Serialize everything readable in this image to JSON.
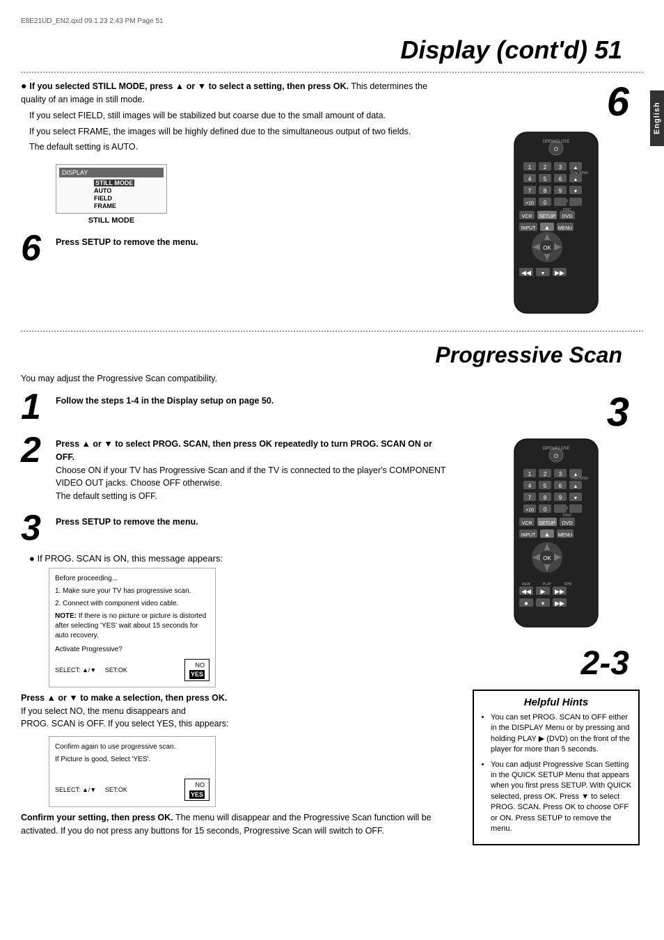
{
  "header": {
    "meta": "E8E21UD_EN2.qxd  09.1.23  2:43 PM  Page 51"
  },
  "english_tab": "English",
  "page_title": "Display (cont'd)  51",
  "section1": {
    "bullet1": {
      "bold_text": "If you selected STILL MODE, press ▲ or ▼ to select a setting, then press OK.",
      "rest": " This determines the quality of an image in still mode."
    },
    "field_text": "If you select FIELD, still images will be stabilized but coarse due to the small amount of data.",
    "frame_text": "If you select FRAME, the images will be highly defined due to the simultaneous output of two fields.",
    "default_text": "The default setting is AUTO.",
    "still_mode_caption": "STILL MODE"
  },
  "step6_display": {
    "num": "6",
    "text": "Press SETUP to remove the menu."
  },
  "section2_title": "Progressive Scan",
  "prog_intro": "You may adjust the Progressive Scan compatibility.",
  "step1": {
    "num": "1",
    "text": "Follow the steps 1-4 in the Display setup on page 50."
  },
  "step2": {
    "num": "2",
    "bold_text": "Press ▲ or ▼ to select PROG. SCAN, then press OK repeatedly to turn PROG. SCAN ON or OFF.",
    "rest": "Choose ON if your TV has Progressive Scan and if the TV is connected to the player's COMPONENT VIDEO OUT jacks. Choose OFF otherwise.",
    "default_text": "The default setting is OFF."
  },
  "step3": {
    "num": "3",
    "text": "Press SETUP to remove the menu."
  },
  "prog_scan_bullet": "If PROG. SCAN is ON, this message appears:",
  "dialog1": {
    "line1": "Before proceeding...",
    "line2": "1. Make sure your TV has progressive scan.",
    "line3": "2. Connect with component video cable.",
    "note": "NOTE: If there is no picture or picture is distorted after selecting 'YES' wait about 15 seconds for auto recovery.",
    "question": "Activate Progressive?",
    "select_text": "SELECT: ▲/▼",
    "set_text": "SET:OK",
    "no": "NO",
    "yes": "YES"
  },
  "press_text": {
    "bold": "Press ▲ or ▼ to make a selection, then press OK.",
    "rest1": "If you select NO, the menu disappears and",
    "rest2": "PROG. SCAN is OFF. If you select YES, this appears:"
  },
  "dialog2": {
    "line1": "Confirm again to use progressive scan.",
    "line2": "If Picture is good, Select 'YES'.",
    "select_text": "SELECT: ▲/▼",
    "set_text": "SET:OK",
    "no": "NO",
    "yes": "YES"
  },
  "confirm_text": {
    "bold": "Confirm your setting, then press OK.",
    "rest": " The menu will disappear and the Progressive Scan function will be activated. If you do not press any buttons for 15 seconds, Progressive Scan will switch to OFF."
  },
  "helpful_hints": {
    "title": "Helpful Hints",
    "hint1": "You can set PROG. SCAN to OFF either in the DISPLAY Menu or by pressing and holding PLAY ▶ (DVD) on the front of the player for more than 5 seconds.",
    "hint2": "You can adjust Progressive Scan Setting in the QUICK SETUP Menu that appears when you first press SETUP. With QUICK selected, press OK. Press ▼ to select PROG. SCAN. Press OK to choose OFF or ON. Press SETUP to remove the menu."
  },
  "right_step6": "6",
  "right_step3": "3",
  "right_step23": "2-3"
}
